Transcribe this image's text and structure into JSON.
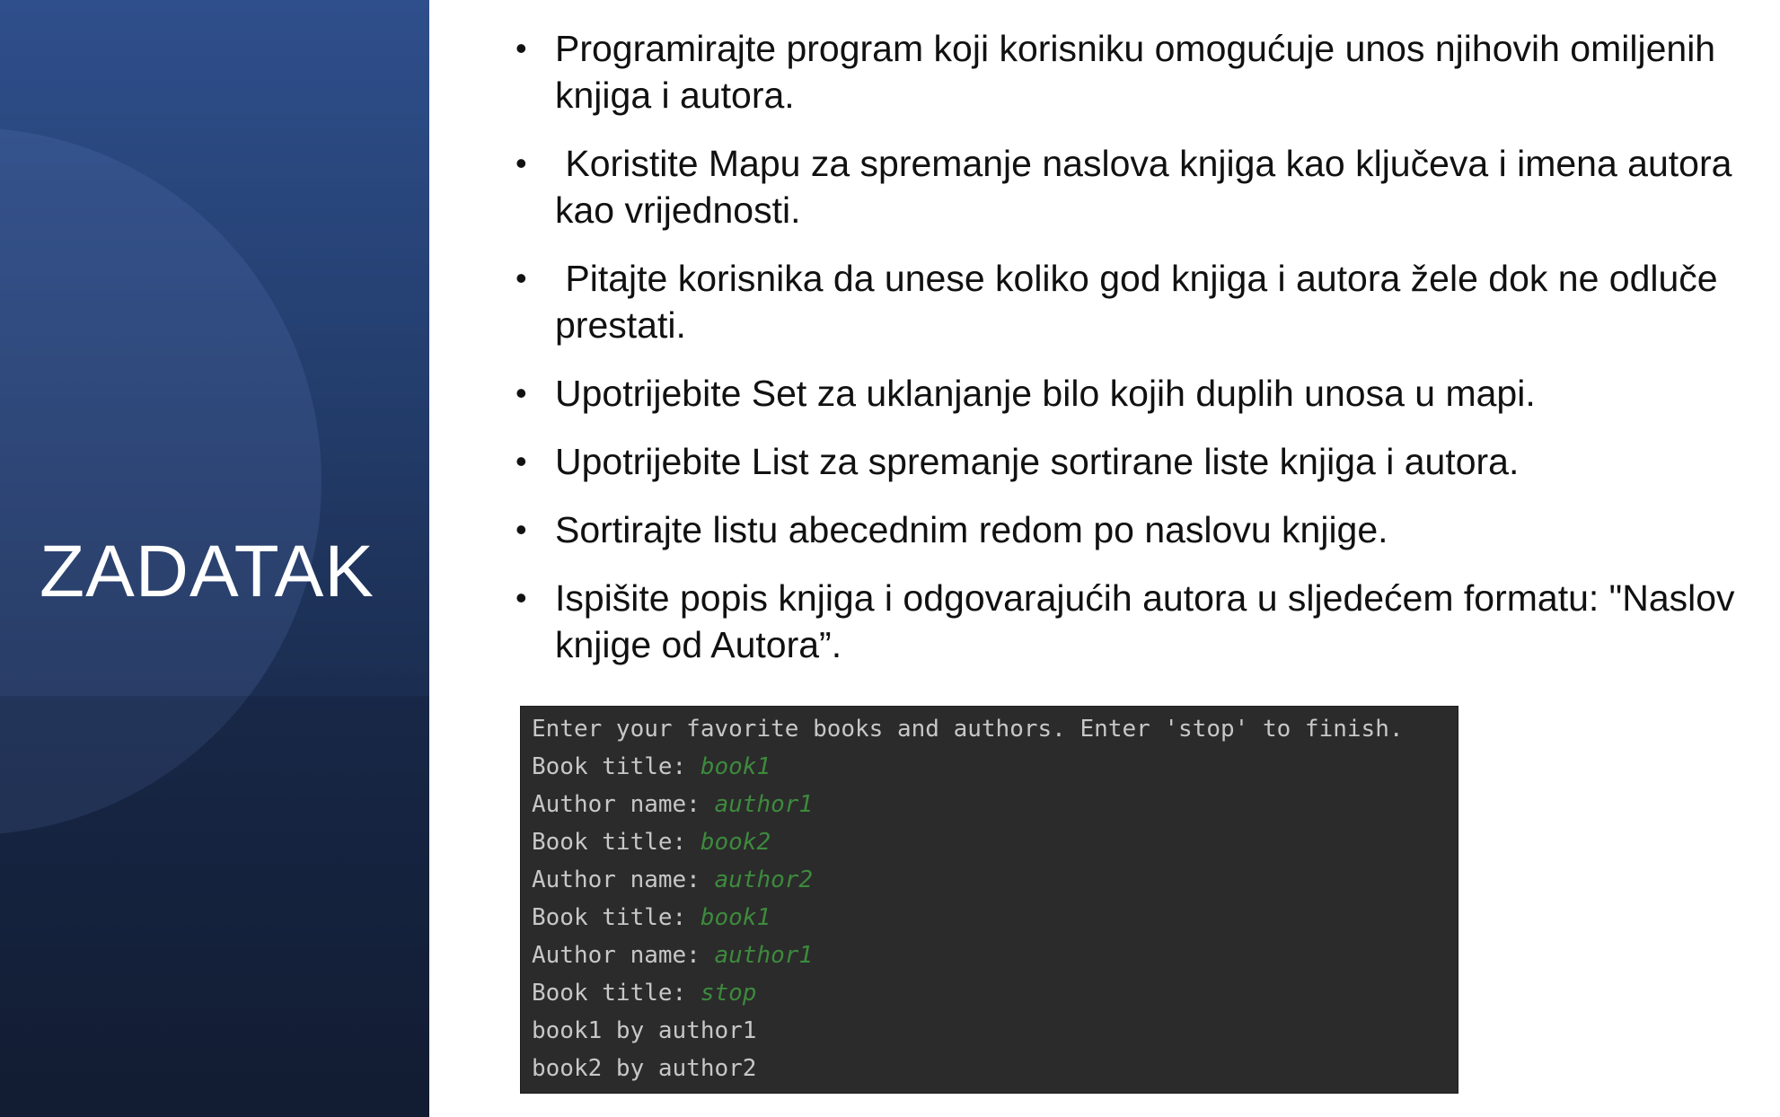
{
  "slide": {
    "title": "ZADATAK"
  },
  "bullets": [
    "Programirajte program koji korisniku omogućuje unos njihovih omiljenih knjiga i autora.",
    " Koristite Mapu za spremanje naslova knjiga kao ključeva i imena autora kao vrijednosti.",
    " Pitajte korisnika da unese koliko god knjiga i autora žele dok ne odluče prestati.",
    "Upotrijebite Set za uklanjanje bilo kojih duplih unosa u mapi.",
    "Upotrijebite List za spremanje sortirane liste knjiga i autora.",
    "Sortirajte listu abecednim redom po naslovu knjige.",
    "Ispišite popis knjiga i odgovarajućih autora u sljedećem formatu: \"Naslov knjige od Autora”."
  ],
  "console": {
    "lines": [
      {
        "prompt": "Enter your favorite books and authors. Enter 'stop' to finish.",
        "input": ""
      },
      {
        "prompt": "Book title: ",
        "input": "book1"
      },
      {
        "prompt": "Author name: ",
        "input": "author1"
      },
      {
        "prompt": "Book title: ",
        "input": "book2"
      },
      {
        "prompt": "Author name: ",
        "input": "author2"
      },
      {
        "prompt": "Book title: ",
        "input": "book1"
      },
      {
        "prompt": "Author name: ",
        "input": "author1"
      },
      {
        "prompt": "Book title: ",
        "input": "stop"
      },
      {
        "prompt": "book1 by author1",
        "input": ""
      },
      {
        "prompt": "book2 by author2",
        "input": ""
      }
    ],
    "colors": {
      "background": "#2b2b2b",
      "text": "#c7c7c7",
      "input": "#3d8a3d"
    }
  },
  "colors": {
    "panel_top": "#2f4f8c",
    "panel_bottom": "#141f36",
    "title": "#ffffff",
    "body_text": "#111111"
  }
}
